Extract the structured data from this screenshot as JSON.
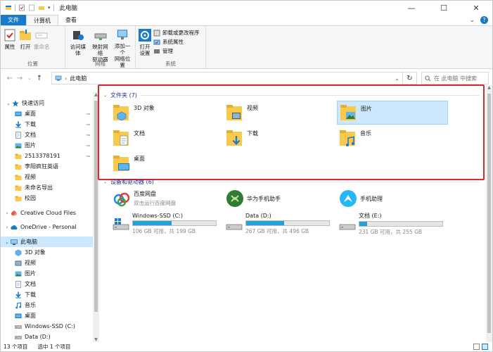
{
  "window": {
    "title": "此电脑",
    "controls": {
      "minimize": "—",
      "maximize": "☐",
      "close": "✕"
    }
  },
  "ribbon_tabs": [
    {
      "label": "文件"
    },
    {
      "label": "计算机"
    },
    {
      "label": "查看"
    }
  ],
  "ribbon": {
    "location_group": {
      "label": "位置",
      "properties": "属性",
      "open": "打开",
      "rename": "重命名"
    },
    "network_group": {
      "label": "网络",
      "access_media": "访问媒体",
      "map_drive": "映射网络\n驱动器",
      "add_location": "添加一个\n网络位置"
    },
    "system_group": {
      "label": "系统",
      "open_settings": "打开\n设置",
      "uninstall": "卸载或更改程序",
      "system_properties": "系统属性",
      "manage": "管理"
    }
  },
  "address_bar": {
    "path": "此电脑",
    "search_placeholder": "在 此电脑 中搜索"
  },
  "nav_pane": {
    "items": [
      {
        "label": "快速访问",
        "icon": "star-icon",
        "pinned": false
      },
      {
        "label": "桌面",
        "icon": "desktop-icon",
        "pinned": true
      },
      {
        "label": "下载",
        "icon": "download-icon",
        "pinned": true
      },
      {
        "label": "文档",
        "icon": "document-icon",
        "pinned": true
      },
      {
        "label": "图片",
        "icon": "pictures-icon",
        "pinned": true
      },
      {
        "label": "2513378191",
        "icon": "folder-icon",
        "pinned": true
      },
      {
        "label": "李阳疯狂英语",
        "icon": "folder-icon",
        "pinned": false
      },
      {
        "label": "视频",
        "icon": "folder-icon",
        "pinned": false
      },
      {
        "label": "未命名导出",
        "icon": "folder-icon",
        "pinned": false
      },
      {
        "label": "校园",
        "icon": "folder-icon",
        "pinned": false
      },
      {
        "label": "Creative Cloud Files",
        "icon": "creative-cloud-icon",
        "pinned": false
      },
      {
        "label": "OneDrive - Personal",
        "icon": "onedrive-icon",
        "pinned": false
      },
      {
        "label": "此电脑",
        "icon": "this-pc-icon",
        "pinned": false
      },
      {
        "label": "3D 对象",
        "icon": "3d-objects-icon",
        "pinned": false
      },
      {
        "label": "视频",
        "icon": "videos-icon",
        "pinned": false
      },
      {
        "label": "图片",
        "icon": "pictures-icon",
        "pinned": false
      },
      {
        "label": "文档",
        "icon": "document-icon",
        "pinned": false
      },
      {
        "label": "下载",
        "icon": "download-icon",
        "pinned": false
      },
      {
        "label": "音乐",
        "icon": "music-icon",
        "pinned": false
      },
      {
        "label": "桌面",
        "icon": "desktop-icon",
        "pinned": false
      },
      {
        "label": "Windows-SSD (C:)",
        "icon": "drive-icon",
        "pinned": false
      },
      {
        "label": "Data (D:)",
        "icon": "drive-icon",
        "pinned": false
      }
    ]
  },
  "folders_section": {
    "header": "文件夹 (7)",
    "folders": [
      {
        "label": "3D 对象",
        "icon": "3d-objects-folder-icon"
      },
      {
        "label": "视频",
        "icon": "videos-folder-icon"
      },
      {
        "label": "图片",
        "icon": "pictures-folder-icon"
      },
      {
        "label": "文档",
        "icon": "documents-folder-icon"
      },
      {
        "label": "下载",
        "icon": "downloads-folder-icon"
      },
      {
        "label": "音乐",
        "icon": "music-folder-icon"
      },
      {
        "label": "桌面",
        "icon": "desktop-folder-icon"
      }
    ]
  },
  "devices_section": {
    "header": "设备和驱动器 (6)",
    "apps": [
      {
        "label": "百度网盘",
        "sub": "双击运行百度网盘",
        "icon": "baidu-netdisk-icon"
      },
      {
        "label": "华为手机助手",
        "sub": "",
        "icon": "huawei-hisuite-icon"
      },
      {
        "label": "手机助理",
        "sub": "",
        "icon": "phone-assistant-icon"
      }
    ],
    "drives": [
      {
        "label": "Windows-SSD (C:)",
        "free": "106 GB 可用，共 199 GB",
        "used_fraction": 0.47
      },
      {
        "label": "Data (D:)",
        "free": "267 GB 可用，共 496 GB",
        "used_fraction": 0.46
      },
      {
        "label": "文档 (E:)",
        "free": "231 GB 可用，共 255 GB",
        "used_fraction": 0.09
      }
    ]
  },
  "status_bar": {
    "item_count": "13 个项目",
    "selection": "选中 1 个项目"
  },
  "colors": {
    "accent": "#1979ca",
    "selection": "#cce8ff",
    "highlight_border": "#d9282d",
    "drive_fill": "#26a0da",
    "folder_yellow": "#f8c94a"
  }
}
